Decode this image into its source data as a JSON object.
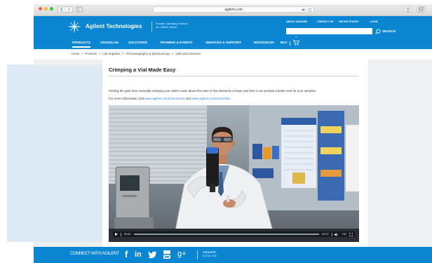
{
  "colors": {
    "brand_blue": "#0a86d2",
    "link_blue": "#2a7fd4",
    "page_bg": "#eef0f2",
    "panel_blue": "#dde9f3"
  },
  "browser": {
    "url": "agilent.com"
  },
  "header": {
    "brand": "Agilent Technologies",
    "tagline": [
      "Premier Laboratory Partner",
      "for a Better World"
    ],
    "utility_links": [
      "ABOUT AGILENT",
      "CONTACT US",
      "UNITED STATES",
      "LOGIN"
    ],
    "search_button": "SEARCH",
    "nav": [
      "PRODUCTS",
      "CROSSLAB",
      "SOLUTIONS",
      "TRAINING & EVENTS",
      "SERVICES & SUPPORT",
      "RESOURCES",
      "BUY"
    ],
    "nav_active_index": 0,
    "cart_count": "0"
  },
  "breadcrumb": {
    "separator": ">",
    "items": [
      "Home",
      "Products",
      "Lab Supplies",
      "Chromatography & Spectroscopy",
      "Vials and Closures"
    ]
  },
  "article": {
    "title": "Crimping a Vial Made Easy",
    "intro": "Feeling the pain from manually crimping your vials? Learn about the ease of the electronic crimper and how it can provide a better seal for your samples.",
    "more_info_prefix": "For more information, visit",
    "link_1": "www.agilent.com/chem/crimp",
    "conjunction": "and",
    "link_2": "www.agilent.com/chem/vials",
    "suffix": "."
  },
  "video": {
    "time_current": "00:00",
    "time_total": "00:57",
    "quality": "HD"
  },
  "footer": {
    "connect_label": "CONNECT WITH AGILENT",
    "social": [
      {
        "icon": "facebook-icon",
        "glyph": "f"
      },
      {
        "icon": "linkedin-icon",
        "glyph": "in"
      },
      {
        "icon": "twitter-icon"
      },
      {
        "icon": "youtube-icon"
      },
      {
        "icon": "googleplus-icon",
        "glyph": "g+"
      }
    ],
    "hub": [
      "AGILENT",
      "SOCIAL HUB"
    ]
  }
}
